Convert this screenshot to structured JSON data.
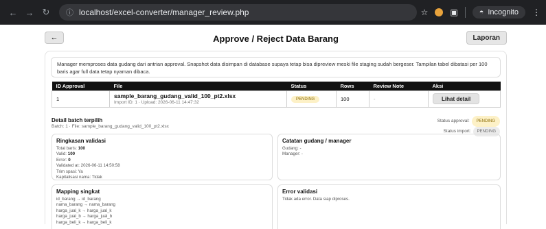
{
  "browser": {
    "url": "localhost/excel-converter/manager_review.php",
    "incognito_label": "Incognito"
  },
  "header": {
    "back_label": "←",
    "title": "Approve / Reject Data Barang",
    "report_label": "Laporan"
  },
  "intro": "Manager memproses data gudang dari antrian approval. Snapshot data disimpan di database supaya tetap bisa dipreview meski file staging sudah bergeser. Tampilan tabel dibatasi per 100 baris agar full data tetap nyaman dibaca.",
  "table": {
    "columns": [
      "ID Approval",
      "File",
      "Status",
      "Rows",
      "Review Note",
      "Aksi"
    ],
    "rows": [
      {
        "id": "1",
        "file_name": "sample_barang_gudang_valid_100_pt2.xlsx",
        "file_meta": "Import ID: 1 · Upload: 2026-06-11 14:47:32",
        "status": "PENDING",
        "rows": "100",
        "note": "-",
        "action": "Lihat detail"
      }
    ]
  },
  "batch": {
    "title": "Detail batch terpilih",
    "subtitle": "Batch: 1 · File: sample_barang_gudang_valid_100_pt2.xlsx",
    "approval_label": "Status approval:",
    "approval_value": "PENDING",
    "import_label": "Status import:",
    "import_value": "PENDING"
  },
  "summary": {
    "title": "Ringkasan validasi",
    "total_label": "Total baris:",
    "total_value": "100",
    "valid_label": "Valid:",
    "valid_value": "100",
    "error_label": "Error:",
    "error_value": "0",
    "validated_at": "Validated at: 2026-06-11 14:50:58",
    "trim": "Trim spasi: Ya",
    "capitalize": "Kapitalisasi nama: Tidak"
  },
  "notes": {
    "title": "Catatan gudang / manager",
    "gudang": "Gudang: -",
    "manager": "Manager: -"
  },
  "mapping": {
    "title": "Mapping singkat",
    "lines": [
      "id_barang → id_barang",
      "nama_barang → nama_barang",
      "harga_jual_k → harga_jual_k",
      "harga_jual_b → harga_jual_b",
      "harga_beli_k → harga_beli_k"
    ]
  },
  "errors": {
    "title": "Error validasi",
    "message": "Tidak ada error. Data siap diproses."
  }
}
